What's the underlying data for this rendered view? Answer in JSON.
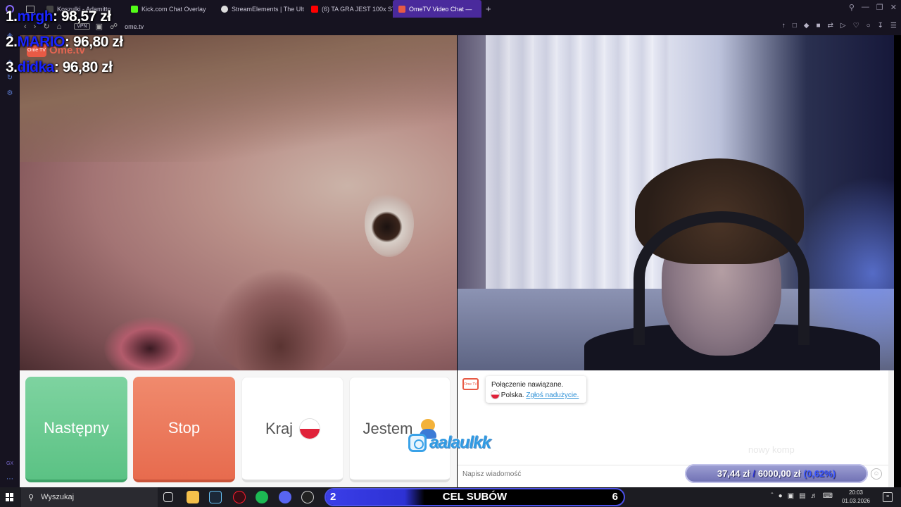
{
  "leaderboard": [
    {
      "rank": "1.",
      "name": "mrgh",
      "amount": ": 98,57 zł"
    },
    {
      "rank": "2.",
      "name": "MARIO",
      "amount": ": 96,80 zł"
    },
    {
      "rank": "3.",
      "name": "didka",
      "amount": ": 96,80 zł"
    }
  ],
  "browser": {
    "tabs": [
      {
        "label": "Koszulki - Adamitto",
        "icon_color": "#444"
      },
      {
        "label": "Kick.com Chat Overlay",
        "icon_color": "#53fc18"
      },
      {
        "label": "StreamElements | The Ult",
        "icon_color": "#ddd"
      },
      {
        "label": "(6) TA GRA JEST 100x STR",
        "icon_color": "#ff0000"
      },
      {
        "label": "OmeTV Video Chat —",
        "icon_color": "#e85a45"
      }
    ],
    "new_tab": "+",
    "vpn_badge": "VPN",
    "url": "ome.tv"
  },
  "ometv": {
    "logo_text": "Ome.tv",
    "logo_badge": "Ome TV",
    "buttons": {
      "next": "Następny",
      "stop": "Stop",
      "country": "Kraj",
      "gender": "Jestem"
    },
    "chat": {
      "avatar_label": "Ome TV",
      "connected": "Połączenie nawiązane.",
      "country": "Polska.",
      "report_link": "Zgłoś nadużycie.",
      "input_placeholder": "Napisz wiadomość",
      "watermark": "nowy komp"
    }
  },
  "overlays": {
    "instagram_handle": "aalaulkk",
    "donation_goal": {
      "current": "37,44 zł",
      "separator": "/",
      "target": "6000,00 zł",
      "percent": "(0,62%)"
    },
    "sub_goal": {
      "current": "2",
      "label": "CEL SUBÓW",
      "target": "6",
      "fill_fraction": 0.33
    }
  },
  "taskbar": {
    "search_placeholder": "Wyszukaj",
    "time": "20:03",
    "date": "01.03.2026"
  },
  "colors": {
    "accent_tab": "#4a2a9c",
    "next_button": "#5bc284",
    "stop_button": "#e76b4e",
    "leaderboard_name": "#1a24ff",
    "sub_goal_bar": "#3a3ee8"
  }
}
